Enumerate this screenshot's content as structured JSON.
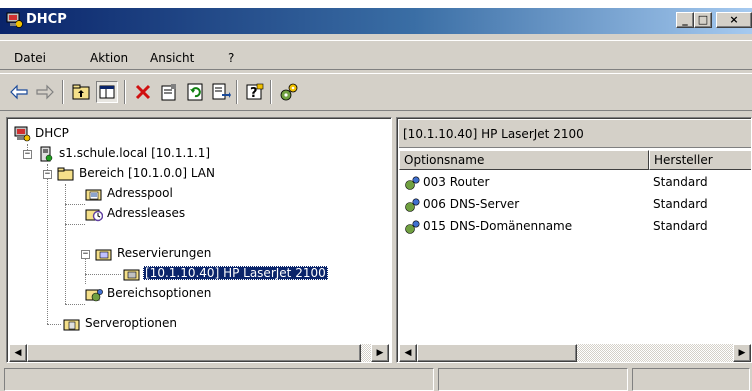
{
  "window": {
    "title": "DHCP",
    "buttons": {
      "minimize": "_",
      "maximize": "□",
      "close": "×"
    }
  },
  "menu": [
    {
      "label": "Datei"
    },
    {
      "label": "Aktion"
    },
    {
      "label": "Ansicht"
    },
    {
      "label": "?"
    }
  ],
  "toolbar": {
    "buttons": [
      {
        "name": "back-arrow-icon",
        "glyph": "⇦"
      },
      {
        "name": "forward-arrow-icon",
        "glyph": "⇨"
      },
      {
        "name": "up-folder-icon"
      },
      {
        "name": "show-hide-tree-icon",
        "pressed": true
      },
      {
        "name": "delete-icon",
        "glyph": "✕"
      },
      {
        "name": "properties-icon"
      },
      {
        "name": "refresh-icon"
      },
      {
        "name": "export-list-icon"
      },
      {
        "name": "help-icon"
      },
      {
        "name": "configure-options-icon"
      }
    ]
  },
  "tree": {
    "root": "DHCP",
    "server": "s1.schule.local [10.1.1.1]",
    "scope": "Bereich [10.1.0.0] LAN",
    "address_pool": "Adresspool",
    "address_leases": "Adressleases",
    "reservations": "Reservierungen",
    "reservation_item": "[10.1.10.40] HP LaserJet 2100",
    "scope_options": "Bereichsoptionen",
    "server_options": "Serveroptionen"
  },
  "list": {
    "title": "[10.1.10.40] HP LaserJet 2100",
    "columns": [
      "Optionsname",
      "Hersteller"
    ],
    "rows": [
      {
        "name": "003 Router",
        "vendor": "Standard"
      },
      {
        "name": "006 DNS-Server",
        "vendor": "Standard"
      },
      {
        "name": "015 DNS-Domänenname",
        "vendor": "Standard"
      }
    ]
  },
  "colors": {
    "title_gradient_start": "#0a246a",
    "title_gradient_end": "#a6caf0",
    "selection": "#0a246a",
    "window_bg": "#d4d0c8"
  }
}
